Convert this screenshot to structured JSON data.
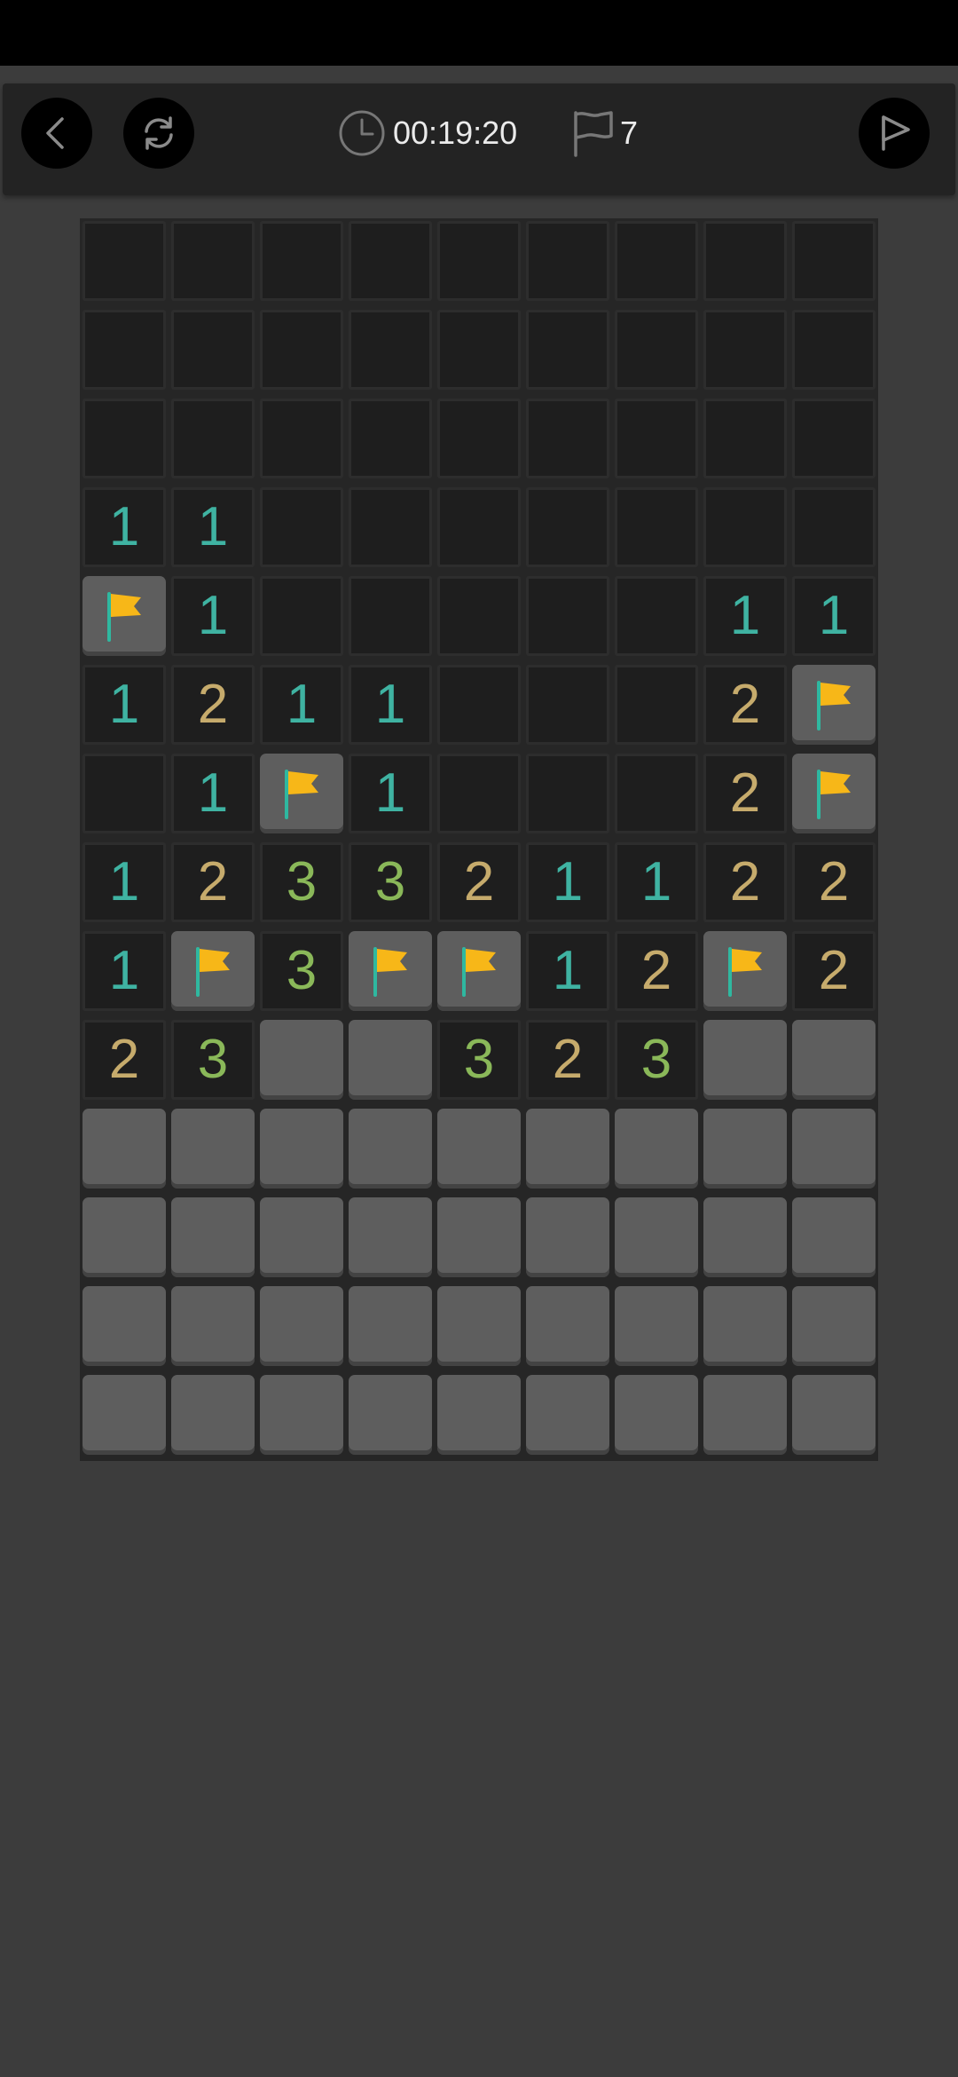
{
  "header": {
    "timer": "00:19:20",
    "flag_count": "7",
    "icons": {
      "back": "chevron-left-icon",
      "restart": "refresh-icon",
      "timer": "clock-icon",
      "flags": "flag-outline-icon",
      "hint": "play-triangle-icon"
    }
  },
  "colors": {
    "background": "#3c3c3c",
    "board": "#262626",
    "revealed_cell": "#1e1e1e",
    "unrevealed_cell": "#5e5e5e",
    "flag_fill": "#f7b718",
    "flag_pole": "#2fb8a0",
    "num_1": "#3fb3a2",
    "num_2": "#c6ab6c",
    "num_3": "#8ab859"
  },
  "board": {
    "columns": 9,
    "rows": 14,
    "legend": ". = dark unrevealed square, 1-8 = revealed number, F = flag, # = raised grey unrevealed square",
    "grid": [
      [
        ".",
        ".",
        ".",
        ".",
        ".",
        ".",
        ".",
        ".",
        "."
      ],
      [
        ".",
        ".",
        ".",
        ".",
        ".",
        ".",
        ".",
        ".",
        "."
      ],
      [
        ".",
        ".",
        ".",
        ".",
        ".",
        ".",
        ".",
        ".",
        "."
      ],
      [
        "1",
        "1",
        ".",
        ".",
        ".",
        ".",
        ".",
        ".",
        "."
      ],
      [
        "F",
        "1",
        ".",
        ".",
        ".",
        ".",
        ".",
        "1",
        "1"
      ],
      [
        "1",
        "2",
        "1",
        "1",
        ".",
        ".",
        ".",
        "2",
        "F"
      ],
      [
        ".",
        "1",
        "F",
        "1",
        ".",
        ".",
        ".",
        "2",
        "F"
      ],
      [
        "1",
        "2",
        "3",
        "3",
        "2",
        "1",
        "1",
        "2",
        "2"
      ],
      [
        "1",
        "F",
        "3",
        "F",
        "F",
        "1",
        "2",
        "F",
        "2"
      ],
      [
        "2",
        "3",
        "#",
        "#",
        "3",
        "2",
        "3",
        "#",
        "#"
      ],
      [
        "#",
        "#",
        "#",
        "#",
        "#",
        "#",
        "#",
        "#",
        "#"
      ],
      [
        "#",
        "#",
        "#",
        "#",
        "#",
        "#",
        "#",
        "#",
        "#"
      ],
      [
        "#",
        "#",
        "#",
        "#",
        "#",
        "#",
        "#",
        "#",
        "#"
      ],
      [
        "#",
        "#",
        "#",
        "#",
        "#",
        "#",
        "#",
        "#",
        "#"
      ]
    ]
  }
}
